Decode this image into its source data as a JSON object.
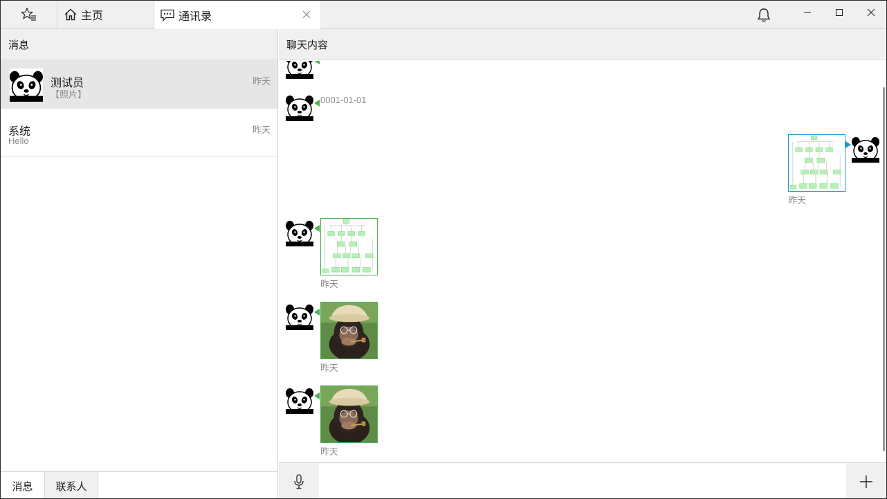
{
  "titlebar": {
    "tabs": [
      {
        "label": "主页",
        "icon": "home-icon"
      },
      {
        "label": "通讯录",
        "icon": "chat-icon"
      }
    ],
    "star_icon": "star-list-icon",
    "bell_icon": "bell-icon"
  },
  "sidebar": {
    "header": "消息",
    "conversations": [
      {
        "name": "测试员",
        "preview": "【照片】",
        "time": "昨天",
        "selected": true,
        "avatar": "panda-avatar"
      },
      {
        "name": "系统",
        "preview": "Hello",
        "time": "昨天",
        "selected": false
      }
    ],
    "bottom_tabs": [
      "消息",
      "联系人"
    ]
  },
  "chat": {
    "header": "聊天内容",
    "messages": [
      {
        "side": "left",
        "type": "text",
        "text": "0001-01-01"
      },
      {
        "side": "left",
        "type": "text",
        "text": "0001-01-01"
      },
      {
        "side": "right",
        "type": "image",
        "image": "flowchart-diagram",
        "time": "昨天"
      },
      {
        "side": "left",
        "type": "image",
        "image": "flowchart-diagram",
        "time": "昨天"
      },
      {
        "side": "left",
        "type": "image",
        "image": "chimpanzee-photo",
        "time": "昨天"
      },
      {
        "side": "left",
        "type": "image",
        "image": "chimpanzee-photo",
        "time": "昨天"
      }
    ],
    "input": {
      "value": "",
      "placeholder": ""
    }
  },
  "colors": {
    "incoming_accent": "#4caf50",
    "outgoing_accent": "#2196d3",
    "header_bg": "#f0f0f0",
    "selected_bg": "#e6e6e6",
    "muted_text": "#8a8a8a"
  }
}
